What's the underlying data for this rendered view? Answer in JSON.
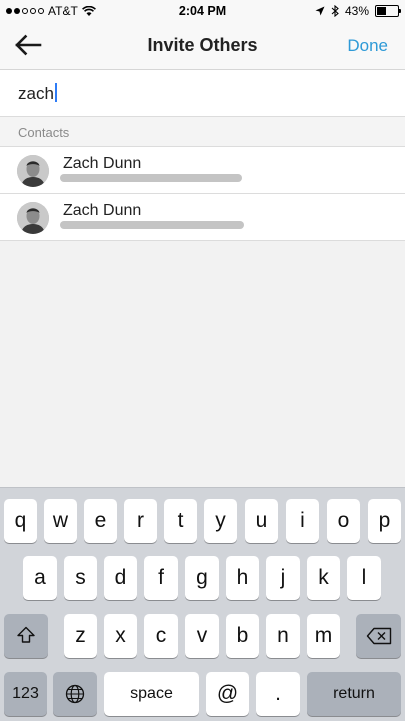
{
  "status_bar": {
    "carrier": "AT&T",
    "time": "2:04 PM",
    "battery_percent": "43%",
    "battery_level": 0.43,
    "signal_bars_filled": 2,
    "icons": [
      "wifi-icon",
      "location-icon",
      "bluetooth-icon",
      "battery-icon"
    ]
  },
  "nav": {
    "title": "Invite Others",
    "done_label": "Done",
    "back_icon": "back-arrow-icon"
  },
  "search": {
    "value": "zach"
  },
  "contacts_section": {
    "header": "Contacts",
    "items": [
      {
        "name": "Zach Dunn"
      },
      {
        "name": "Zach Dunn"
      }
    ]
  },
  "keyboard": {
    "row1": [
      "q",
      "w",
      "e",
      "r",
      "t",
      "y",
      "u",
      "i",
      "o",
      "p"
    ],
    "row2": [
      "a",
      "s",
      "d",
      "f",
      "g",
      "h",
      "j",
      "k",
      "l"
    ],
    "row3": [
      "z",
      "x",
      "c",
      "v",
      "b",
      "n",
      "m"
    ],
    "numbers_label": "123",
    "space_label": "space",
    "at_label": "@",
    "period_label": ".",
    "return_label": "return"
  },
  "colors": {
    "accent": "#2e9ad7",
    "keyboard_bg": "#d1d4d9",
    "function_key": "#abb1ba"
  }
}
